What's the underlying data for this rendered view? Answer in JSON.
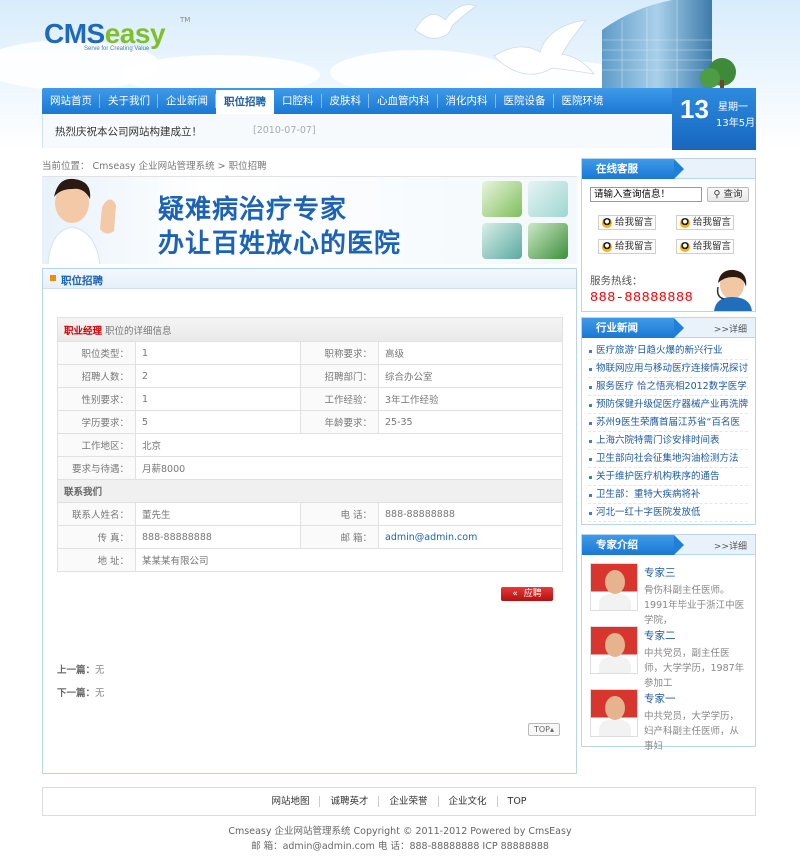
{
  "logo": {
    "brand_a": "CMS",
    "brand_b": "easy",
    "tm": "TM",
    "slogan": "Serve for Creating Value"
  },
  "nav": {
    "items": [
      "网站首页",
      "关于我们",
      "企业新闻",
      "职位招聘",
      "口腔科",
      "皮肤科",
      "心血管内科",
      "消化内科",
      "医院设备",
      "医院环境"
    ],
    "active_index": 3
  },
  "date_widget": {
    "day": "13",
    "weekday": "星期一",
    "year_month": "13年5月"
  },
  "announcement": {
    "text": "热烈庆祝本公司网站构建成立！",
    "date": "[2010-07-07]"
  },
  "breadcrumb": {
    "prefix": "当前位置：",
    "site": "Cmseasy 企业网站管理系统",
    "sep": ">",
    "current": "职位招聘"
  },
  "banner": {
    "line1": "疑难病治疗专家",
    "line2": "办让百姓放心的医院"
  },
  "category": {
    "title": "职位招聘"
  },
  "job": {
    "title": "职业经理",
    "subtitle": "职位的详细信息",
    "rows": [
      {
        "l1": "职位类型：",
        "v1": "1",
        "l2": "职称要求：",
        "v2": "高级"
      },
      {
        "l1": "招聘人数：",
        "v1": "2",
        "l2": "招聘部门：",
        "v2": "综合办公室"
      },
      {
        "l1": "性别要求：",
        "v1": "1",
        "l2": "工作经验：",
        "v2": "3年工作经验"
      },
      {
        "l1": "学历要求：",
        "v1": "5",
        "l2": "年龄要求：",
        "v2": "25-35"
      }
    ],
    "work_area_label": "工作地区：",
    "work_area": "北京",
    "salary_label": "要求与待遇：",
    "salary": "月薪8000",
    "contact_section": "联系我们",
    "contact_name_label": "联系人姓名：",
    "contact_name": "董先生",
    "phone_label": "电  话：",
    "phone": "888-88888888",
    "fax_label": "传  真：",
    "fax": "888-88888888",
    "email_label": "邮  箱：",
    "email": "admin@admin.com",
    "address_label": "地  址：",
    "address": "某某某有限公司"
  },
  "apply_button": "应聘",
  "prev": {
    "label": "上一篇：",
    "value": "无"
  },
  "next": {
    "label": "下一篇：",
    "value": "无"
  },
  "top_button": "TOP",
  "online_service": {
    "title": "在线客服",
    "search_placeholder": "请输入查询信息！",
    "search_button": "查询",
    "qq_buttons": [
      "给我留言",
      "给我留言",
      "给我留言",
      "给我留言"
    ],
    "hotline_label": "服务热线：",
    "hotline": "888-88888888"
  },
  "industry_news": {
    "title": "行业新闻",
    "more": ">>详细",
    "items": [
      "医疗旅游‘日趋火爆的新兴行业",
      "物联网应用与移动医疗连接情况探讨",
      "服务医疗 恰之悟亮相2012数字医学...",
      "预防保健升级促医疗器械产业再洗牌",
      "苏州9医生荣膺首届江苏省“百名医",
      "上海六院特需门诊安排时间表",
      "卫生部向社会征集地沟油检测方法",
      "关于维护医疗机构秩序的通告",
      "卫生部：重特大疾病将补",
      "河北一红十字医院发放低"
    ]
  },
  "experts": {
    "title": "专家介绍",
    "more": ">>详细",
    "items": [
      {
        "name": "专家三",
        "desc": "骨伤科副主任医师。1991年毕业于浙江中医学院，"
      },
      {
        "name": "专家二",
        "desc": "中共党员，副主任医师，大学学历，1987年参加工"
      },
      {
        "name": "专家一",
        "desc": "中共党员，大学学历，妇产科副主任医师，从事妇"
      }
    ]
  },
  "footer": {
    "links": [
      "网站地图",
      "诚聘英才",
      "企业荣誉",
      "企业文化",
      "TOP"
    ],
    "copyright": "Cmseasy 企业网站管理系统 Copyright © 2011-2012 Powered by CmsEasy",
    "contact": "邮 箱：admin@admin.com 电 话：888-88888888 ICP 88888888"
  }
}
